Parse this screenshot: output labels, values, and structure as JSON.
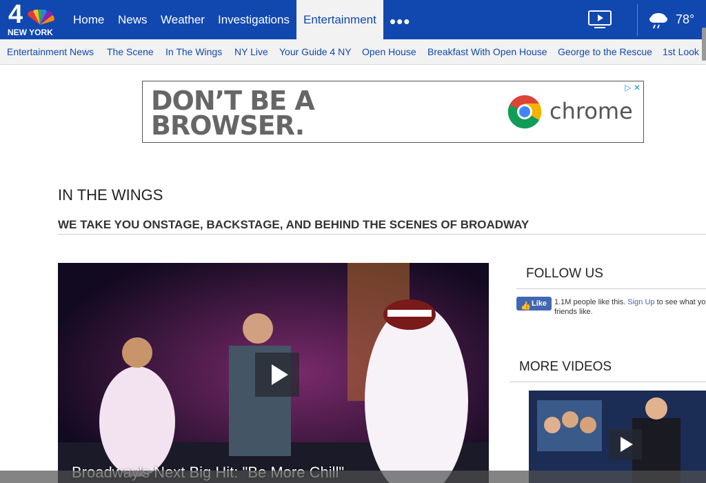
{
  "brand": {
    "channel_number": "4",
    "city": "NEW YORK"
  },
  "topnav": {
    "items": [
      {
        "label": "Home"
      },
      {
        "label": "News"
      },
      {
        "label": "Weather"
      },
      {
        "label": "Investigations"
      },
      {
        "label": "Entertainment",
        "active": true
      }
    ],
    "more_icon": "more-dots-icon",
    "tv_icon": "tv-play-icon",
    "weather_icon": "rain-cloud-icon",
    "temperature": "78°"
  },
  "subnav": {
    "items": [
      {
        "label": "Entertainment News"
      },
      {
        "label": "The Scene"
      },
      {
        "label": "In The Wings"
      },
      {
        "label": "NY Live"
      },
      {
        "label": "Your Guide 4 NY"
      },
      {
        "label": "Open House"
      },
      {
        "label": "Breakfast With Open House"
      },
      {
        "label": "George to the Rescue"
      },
      {
        "label": "1st Look"
      }
    ]
  },
  "ad": {
    "headline_line1": "DON’T BE A",
    "headline_line2": "BROWSER.",
    "brand": "chrome",
    "adchoices": "▷ ✕"
  },
  "section": {
    "title": "IN THE WINGS",
    "subtitle": "WE TAKE YOU ONSTAGE, BACKSTAGE, AND BEHIND THE SCENES OF BROADWAY"
  },
  "main_video": {
    "caption": "Broadway's Next Big Hit: \"Be More Chill\""
  },
  "sidebar": {
    "follow_title": "FOLLOW US",
    "fb_like_label": "Like",
    "fb_count_text": "1.1M people like this.",
    "fb_signup": "Sign Up",
    "fb_tail": "to see what your friends like.",
    "more_videos_title": "MORE VIDEOS"
  },
  "colors": {
    "nav_blue": "#1048b0",
    "subnav_bg": "#f2f2f2",
    "fb_blue": "#4267b2"
  }
}
